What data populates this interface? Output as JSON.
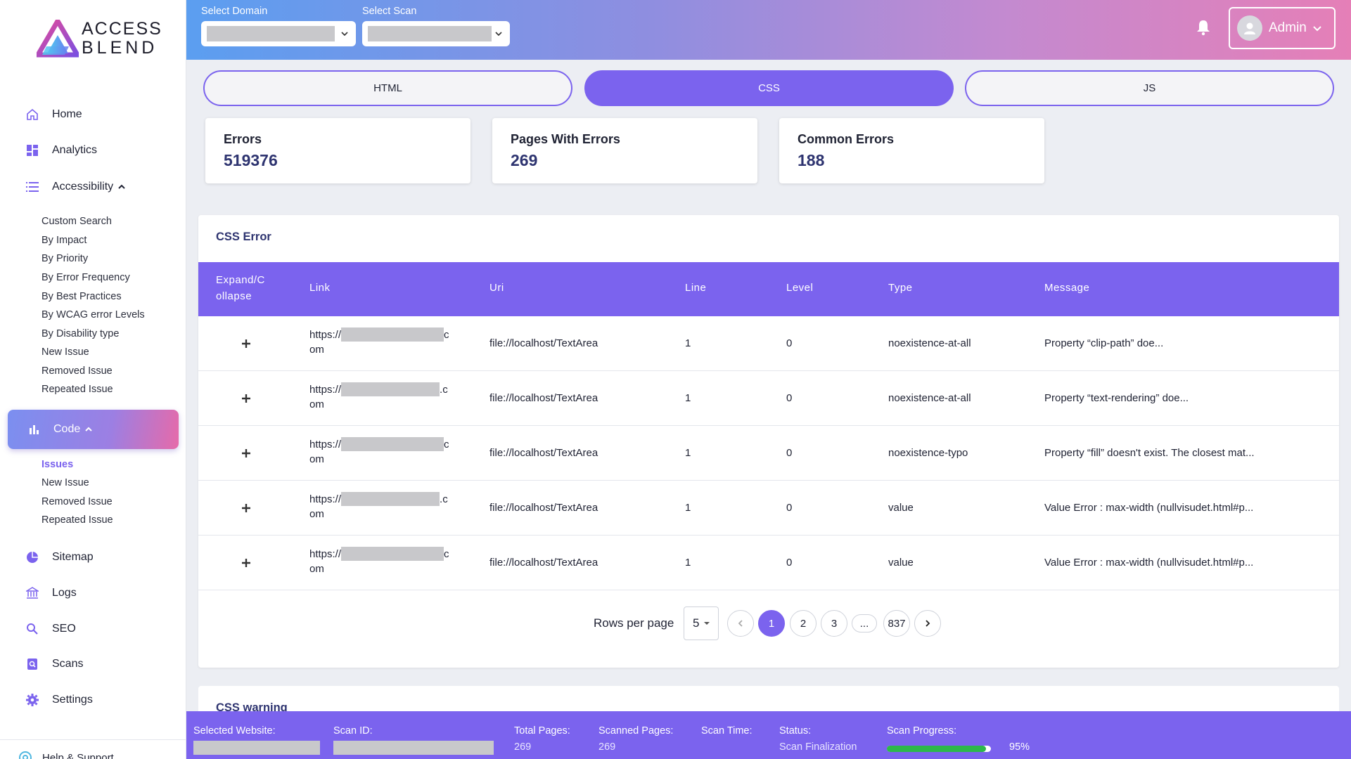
{
  "brand": {
    "line1": "ACCESS",
    "line2": "BLEND"
  },
  "header": {
    "domain_label": "Select Domain",
    "scan_label": "Select Scan",
    "user_name": "Admin"
  },
  "sidebar": {
    "home": "Home",
    "analytics": "Analytics",
    "accessibility": "Accessibility",
    "accessibility_items": [
      "Custom Search",
      "By Impact",
      "By Priority",
      "By Error Frequency",
      "By Best Practices",
      "By WCAG error Levels",
      "By Disability type",
      "New Issue",
      "Removed Issue",
      "Repeated Issue"
    ],
    "code": "Code",
    "code_items": [
      "Issues",
      "New Issue",
      "Removed Issue",
      "Repeated Issue"
    ],
    "sitemap": "Sitemap",
    "logs": "Logs",
    "seo": "SEO",
    "scans": "Scans",
    "settings": "Settings",
    "help": "Help & Support"
  },
  "tabs": [
    "HTML",
    "CSS",
    "JS"
  ],
  "active_tab": "CSS",
  "stats": [
    {
      "title": "Errors",
      "value": "519376"
    },
    {
      "title": "Pages With Errors",
      "value": "269"
    },
    {
      "title": "Common Errors",
      "value": "188"
    }
  ],
  "table": {
    "title": "CSS Error",
    "columns": [
      "Expand/C\nollapse",
      "Link",
      "Uri",
      "Line",
      "Level",
      "Type",
      "Message"
    ],
    "rows": [
      {
        "link_start": "https://",
        "link_end": "c",
        "link_tail": "om",
        "uri": "file://localhost/TextArea",
        "line": "1",
        "level": "0",
        "type": "noexistence-at-all",
        "message": "Property “clip-path” doe..."
      },
      {
        "link_start": "https://",
        "link_end": ".c",
        "link_tail": "om",
        "uri": "file://localhost/TextArea",
        "line": "1",
        "level": "0",
        "type": "noexistence-at-all",
        "message": "Property “text-rendering” doe..."
      },
      {
        "link_start": "https://",
        "link_end": "c",
        "link_tail": "om",
        "uri": "file://localhost/TextArea",
        "line": "1",
        "level": "0",
        "type": "noexistence-typo",
        "message": "Property “fill” doesn't exist. The closest mat..."
      },
      {
        "link_start": "https://",
        "link_end": ".c",
        "link_tail": "om",
        "uri": "file://localhost/TextArea",
        "line": "1",
        "level": "0",
        "type": "value",
        "message": "Value Error : max-width (nullvisudet.html#p..."
      },
      {
        "link_start": "https://",
        "link_end": "c",
        "link_tail": "om",
        "uri": "file://localhost/TextArea",
        "line": "1",
        "level": "0",
        "type": "value",
        "message": "Value Error : max-width (nullvisudet.html#p..."
      }
    ],
    "rows_per_page_label": "Rows per page",
    "rows_per_page": "5",
    "pages": [
      "1",
      "2",
      "3",
      "...",
      "837"
    ],
    "current_page": "1"
  },
  "warning_card": {
    "title": "CSS warning"
  },
  "footer": {
    "selected_website_label": "Selected Website:",
    "scan_id_label": "Scan ID:",
    "total_pages_label": "Total Pages:",
    "total_pages": "269",
    "scanned_pages_label": "Scanned Pages:",
    "scanned_pages": "269",
    "scan_time_label": "Scan Time:",
    "status_label": "Status:",
    "status": "Scan Finalization",
    "progress_label": "Scan Progress:",
    "progress_percent": 95,
    "progress_text": "95%"
  },
  "colors": {
    "accent": "#7b63ee",
    "progress": "#2db84b",
    "redacted": "#c8c8cb"
  },
  "icons": [
    "home-icon",
    "analytics-icon",
    "list-icon",
    "code-chart-icon",
    "sitemap-icon",
    "logs-icon",
    "search-icon",
    "scans-icon",
    "gear-icon",
    "help-icon",
    "bell-icon",
    "user-avatar-icon",
    "chevron-down-icon",
    "plus-icon"
  ]
}
